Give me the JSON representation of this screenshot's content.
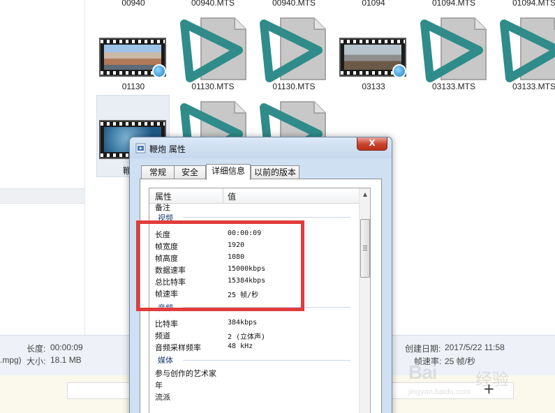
{
  "files": {
    "top_row": [
      "00940",
      "00940.MTS",
      "00940.MTS",
      "01094",
      "01094.MTS",
      "01094.MTS"
    ],
    "middle_row": [
      "01130",
      "01130.MTS",
      "01130.MTS",
      "03133",
      "03133.MTS",
      "03133.MTS"
    ],
    "partial_label": "鞭"
  },
  "status_bar": {
    "left_fragment": ".mpg)",
    "length_label": "长度:",
    "length_value": "00:00:09",
    "size_label": "大小:",
    "size_value": "18.1 MB",
    "created_label": "创建日期:",
    "created_value": "2017/5/22 11:58",
    "framerate_label": "帧速率:",
    "framerate_value": "25 帧/秒"
  },
  "dialog": {
    "title": "鞭炮 属性",
    "close_glyph": "X",
    "tabs": [
      "常规",
      "安全",
      "详细信息",
      "以前的版本"
    ],
    "active_tab": "详细信息",
    "columns": {
      "name": "属性",
      "value": "值"
    },
    "rows_pre": [
      {
        "name": "备注",
        "value": ""
      }
    ],
    "groups": [
      {
        "title": "视频",
        "rows": [
          {
            "name": "长度",
            "value": "00:00:09"
          },
          {
            "name": "帧宽度",
            "value": "1920"
          },
          {
            "name": "帧高度",
            "value": "1080"
          },
          {
            "name": "数据速率",
            "value": "15000kbps"
          },
          {
            "name": "总比特率",
            "value": "15384kbps"
          },
          {
            "name": "帧速率",
            "value": "25 帧/秒"
          }
        ]
      },
      {
        "title": "音频",
        "rows": [
          {
            "name": "比特率",
            "value": "384kbps"
          },
          {
            "name": "频道",
            "value": "2 (立体声)"
          },
          {
            "name": "音频采样频率",
            "value": "48 kHz"
          }
        ]
      },
      {
        "title": "媒体",
        "rows": [
          {
            "name": "参与创作的艺术家",
            "value": ""
          },
          {
            "name": "年",
            "value": ""
          },
          {
            "name": "流派",
            "value": ""
          }
        ]
      }
    ]
  },
  "watermark": {
    "brand": "Bai",
    "brand_cn": "经验",
    "url": "jingyan.baidu.com"
  },
  "plus_glyph": "+",
  "colors": {
    "highlight": "#e23b3b",
    "mts_icon": "#2f8c8a"
  }
}
